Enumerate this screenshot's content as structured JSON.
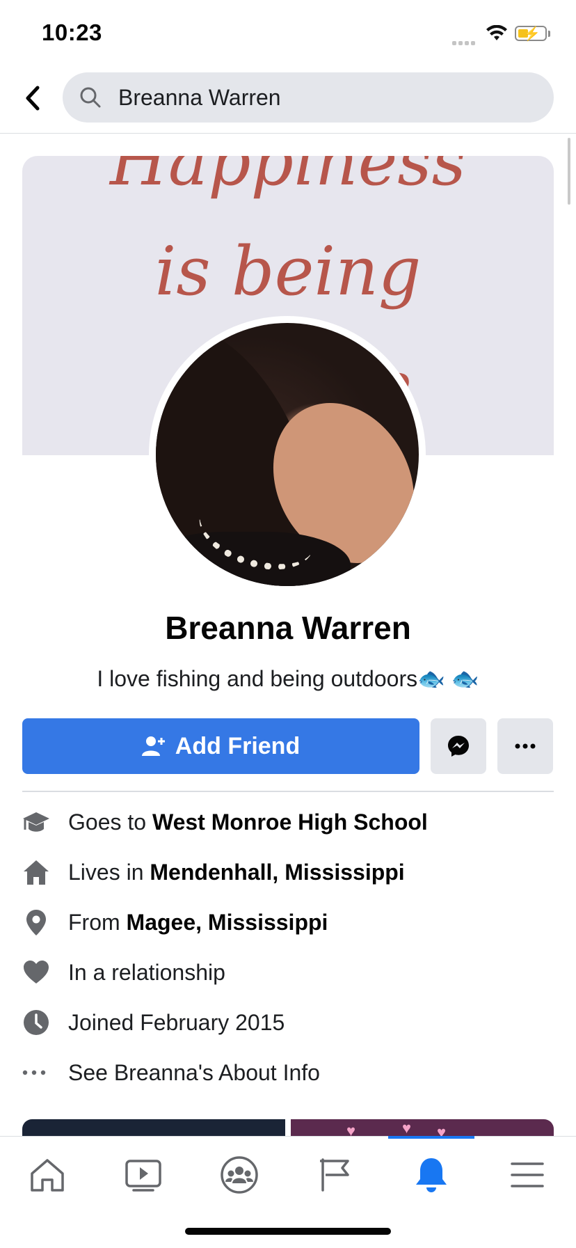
{
  "status_bar": {
    "time": "10:23"
  },
  "search": {
    "query": "Breanna Warren"
  },
  "cover": {
    "lines": [
      "Happiness",
      "is being",
      "a nanie"
    ]
  },
  "profile": {
    "name": "Breanna Warren",
    "bio": "I love fishing and being outdoors🐟 🐟"
  },
  "actions": {
    "add_friend_label": "Add Friend"
  },
  "info": {
    "school_prefix": "Goes to ",
    "school": "West Monroe High School",
    "lives_prefix": "Lives in ",
    "lives": "Mendenhall, Mississippi",
    "from_prefix": "From ",
    "from": "Magee, Mississippi",
    "relationship": "In a relationship",
    "joined": "Joined February 2015",
    "about_link": "See Breanna's About Info"
  },
  "tab_bar": {
    "tabs": [
      "home-icon",
      "watch-icon",
      "groups-icon",
      "pages-icon",
      "notifications-icon",
      "menu-icon"
    ],
    "active": "notifications-icon"
  },
  "colors": {
    "accent": "#3578e5",
    "active_tab": "#1877f2"
  }
}
